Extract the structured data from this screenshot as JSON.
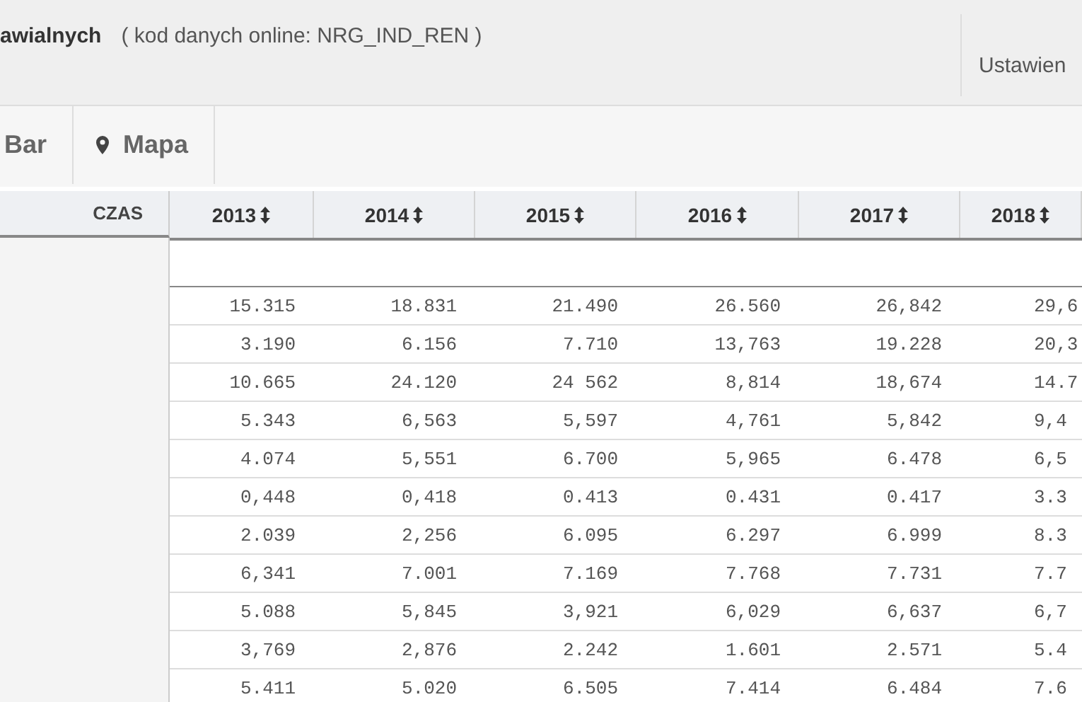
{
  "header": {
    "title": "awialnych",
    "code_text": "( kod danych online: NRG_IND_REN )",
    "settings_label": "Ustawien"
  },
  "tabs": [
    {
      "label": "Bar",
      "selected": false,
      "kind": "plain"
    },
    {
      "label": "Mapa",
      "selected": false,
      "kind": "map"
    }
  ],
  "table": {
    "time_label": "CZAS",
    "columns": [
      "2013",
      "2014",
      "2015",
      "2016",
      "2017",
      "2018"
    ],
    "rows": [
      [
        "15.315",
        "18.831",
        "21.490",
        "26.560",
        "26,842",
        "29,6"
      ],
      [
        "3.190",
        "6.156",
        "7.710",
        "13,763",
        "19.228",
        "20,3"
      ],
      [
        "10.665",
        "24.120",
        "24 562",
        "8,814",
        "18,674",
        "14.7"
      ],
      [
        "5.343",
        "6,563",
        "5,597",
        "4,761",
        "5,842",
        "9,4"
      ],
      [
        "4.074",
        "5,551",
        "6.700",
        "5,965",
        "6.478",
        "6,5"
      ],
      [
        "0,448",
        "0,418",
        "0.413",
        "0.431",
        "0.417",
        "3.3"
      ],
      [
        "2.039",
        "2,256",
        "6.095",
        "6.297",
        "6.999",
        "8.3"
      ],
      [
        "6,341",
        "7.001",
        "7.169",
        "7.768",
        "7.731",
        "7.7"
      ],
      [
        "5.088",
        "5,845",
        "3,921",
        "6,029",
        "6,637",
        "6,7"
      ],
      [
        "3,769",
        "2,876",
        "2.242",
        "1.601",
        "2.571",
        "5.4"
      ],
      [
        "5.411",
        "5.020",
        "6.505",
        "7.414",
        "6.484",
        "7.6"
      ]
    ]
  }
}
